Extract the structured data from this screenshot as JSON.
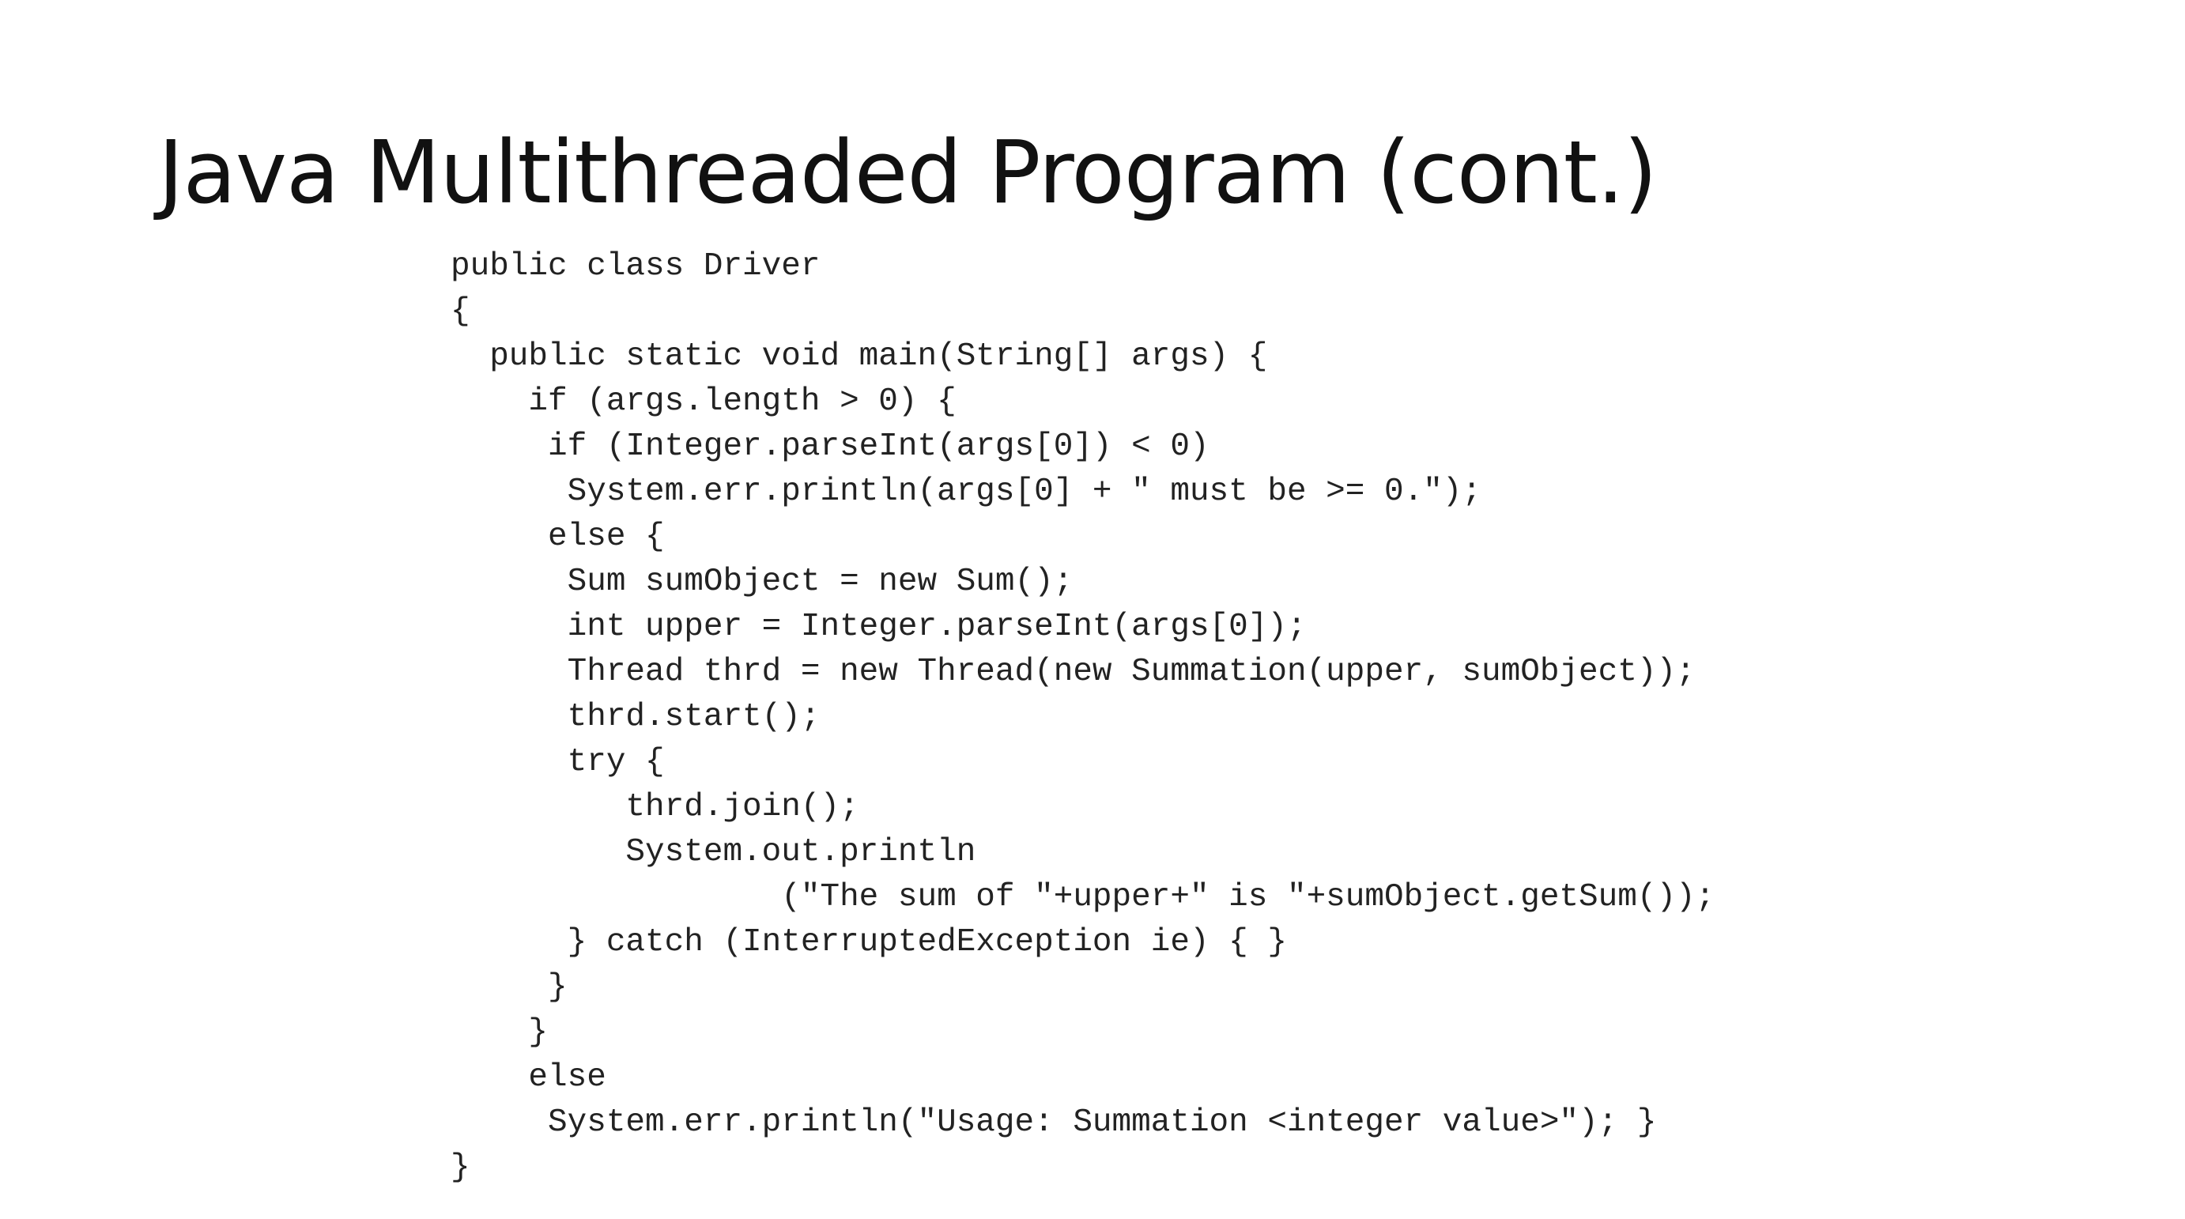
{
  "slide": {
    "title": "Java Multithreaded Program (cont.)"
  },
  "code": {
    "lines": [
      "public class Driver",
      "{",
      "  public static void main(String[] args) {",
      "    if (args.length > 0) {",
      "     if (Integer.parseInt(args[0]) < 0)",
      "      System.err.println(args[0] + \" must be >= 0.\");",
      "     else {",
      "      Sum sumObject = new Sum();",
      "      int upper = Integer.parseInt(args[0]);",
      "      Thread thrd = new Thread(new Summation(upper, sumObject));",
      "      thrd.start();",
      "      try {",
      "         thrd.join();",
      "         System.out.println",
      "                 (\"The sum of \"+upper+\" is \"+sumObject.getSum());",
      "      } catch (InterruptedException ie) { }",
      "     }",
      "    }",
      "    else",
      "     System.err.println(\"Usage: Summation <integer value>\"); }",
      "}"
    ]
  }
}
